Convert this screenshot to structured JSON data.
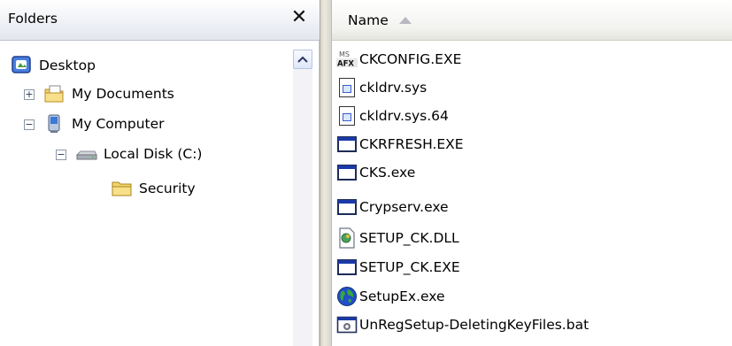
{
  "folders_pane": {
    "title": "Folders",
    "close_label": "✕",
    "tree": [
      {
        "label": "Desktop",
        "icon": "desktop-icon",
        "expander": ""
      },
      {
        "label": "My Documents",
        "icon": "my-documents-icon",
        "expander": "+"
      },
      {
        "label": "My Computer",
        "icon": "my-computer-icon",
        "expander": "−"
      },
      {
        "label": "Local Disk (C:)",
        "icon": "local-disk-icon",
        "expander": "−"
      },
      {
        "label": "Security",
        "icon": "folder-icon",
        "expander": ""
      }
    ]
  },
  "files_pane": {
    "column_name": "Name",
    "files": [
      {
        "name": "CKCONFIG.EXE",
        "icon": "mfc-app-icon"
      },
      {
        "name": "ckldrv.sys",
        "icon": "system-file-icon"
      },
      {
        "name": "ckldrv.sys.64",
        "icon": "system-file-icon"
      },
      {
        "name": "CKRFRESH.EXE",
        "icon": "application-icon"
      },
      {
        "name": "CKS.exe",
        "icon": "application-icon"
      },
      {
        "name": "Crypserv.exe",
        "icon": "application-icon"
      },
      {
        "name": "SETUP_CK.DLL",
        "icon": "dll-icon"
      },
      {
        "name": "SETUP_CK.EXE",
        "icon": "application-icon"
      },
      {
        "name": "SetupEx.exe",
        "icon": "globe-icon"
      },
      {
        "name": "UnRegSetup-DeletingKeyFiles.bat",
        "icon": "batch-file-icon"
      }
    ]
  },
  "colors": {
    "title_blue": "#1b3aa8",
    "folder_yellow": "#f3d36b"
  }
}
